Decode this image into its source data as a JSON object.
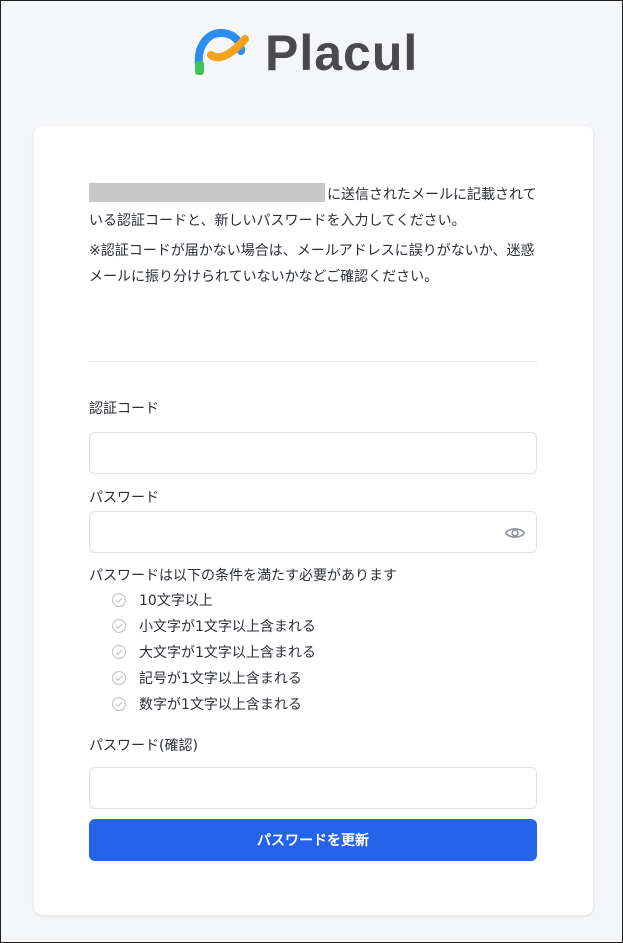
{
  "brand": {
    "name": "Placul"
  },
  "intro": {
    "line1": "に送信されたメールに記載されている認証コードと、新しいパスワードを入力してください。",
    "note": "※認証コードが届かない場合は、メールアドレスに誤りがないか、迷惑メールに振り分けられていないかなどご確認ください。"
  },
  "form": {
    "code_label": "認証コード",
    "code_value": "",
    "password_label": "パスワード",
    "password_value": "",
    "rules_title": "パスワードは以下の条件を満たす必要があります",
    "rules": [
      "10文字以上",
      "小文字が1文字以上含まれる",
      "大文字が1文字以上含まれる",
      "記号が1文字以上含まれる",
      "数字が1文字以上含まれる"
    ],
    "confirm_label": "パスワード(確認)",
    "confirm_value": "",
    "submit_label": "パスワードを更新"
  },
  "colors": {
    "primary": "#2563eb",
    "logo_blue": "#2d8cf0",
    "logo_orange": "#f7a21b",
    "logo_green": "#3cc35a",
    "rule_check": "#c4c7cc"
  },
  "icons": {
    "password_toggle": "eye-icon",
    "rule_status": "check-circle-icon"
  }
}
